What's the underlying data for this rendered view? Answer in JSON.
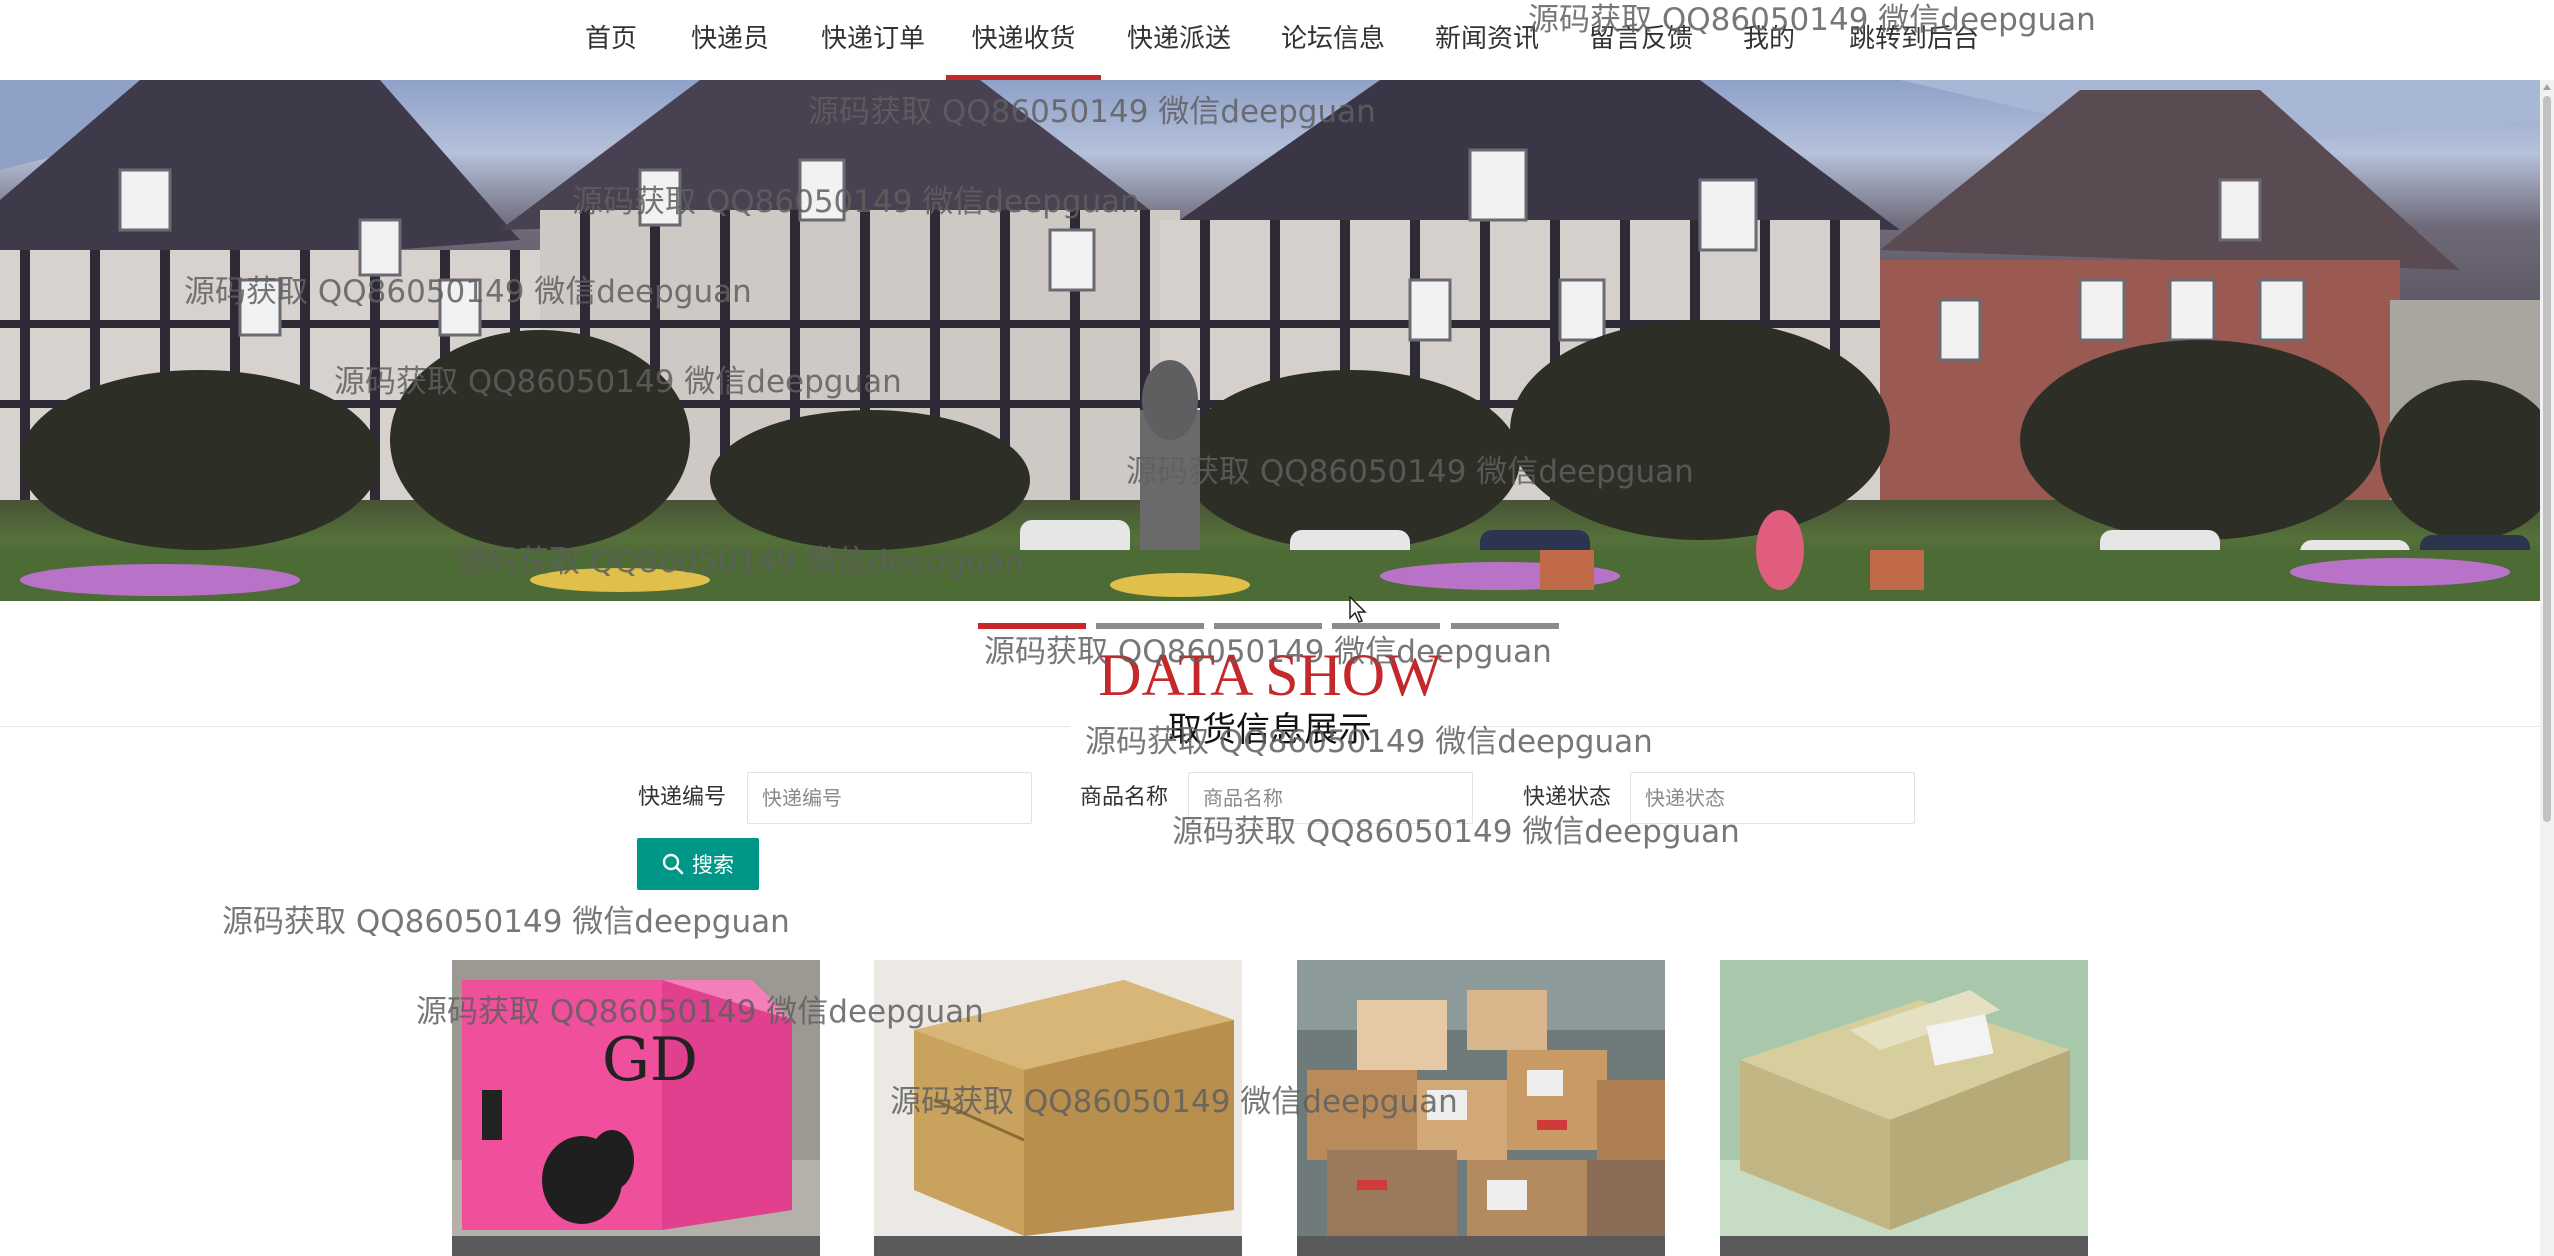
{
  "nav": {
    "items": [
      {
        "label": "首页",
        "active": false
      },
      {
        "label": "快递员",
        "active": false
      },
      {
        "label": "快递订单",
        "active": false
      },
      {
        "label": "快递收货",
        "active": true
      },
      {
        "label": "快递派送",
        "active": false
      },
      {
        "label": "论坛信息",
        "active": false
      },
      {
        "label": "新闻资讯",
        "active": false
      },
      {
        "label": "留言反馈",
        "active": false
      },
      {
        "label": "我的",
        "active": false
      },
      {
        "label": "跳转到后台",
        "active": false
      }
    ]
  },
  "carousel": {
    "slide_count": 5,
    "active_index": 0
  },
  "section": {
    "title": "DATA SHOW",
    "subtitle": "取货信息展示"
  },
  "search": {
    "fields": [
      {
        "label": "快递编号",
        "placeholder": "快递编号",
        "value": ""
      },
      {
        "label": "商品名称",
        "placeholder": "商品名称",
        "value": ""
      },
      {
        "label": "快递状态",
        "placeholder": "快递状态",
        "value": ""
      }
    ],
    "button_label": "搜索"
  },
  "cards": [
    {
      "caption": "",
      "image": "pink-box"
    },
    {
      "caption": "",
      "image": "kraft-box"
    },
    {
      "caption": "",
      "image": "parcel-pile"
    },
    {
      "caption": "",
      "image": "taped-box"
    }
  ],
  "watermark": {
    "text": "源码获取 QQ86050149 微信deepguan"
  },
  "colors": {
    "accent": "#c4282a",
    "button": "#009688",
    "caption_bar": "#5a5a5a",
    "indicator_inactive": "#8b8b8b"
  }
}
